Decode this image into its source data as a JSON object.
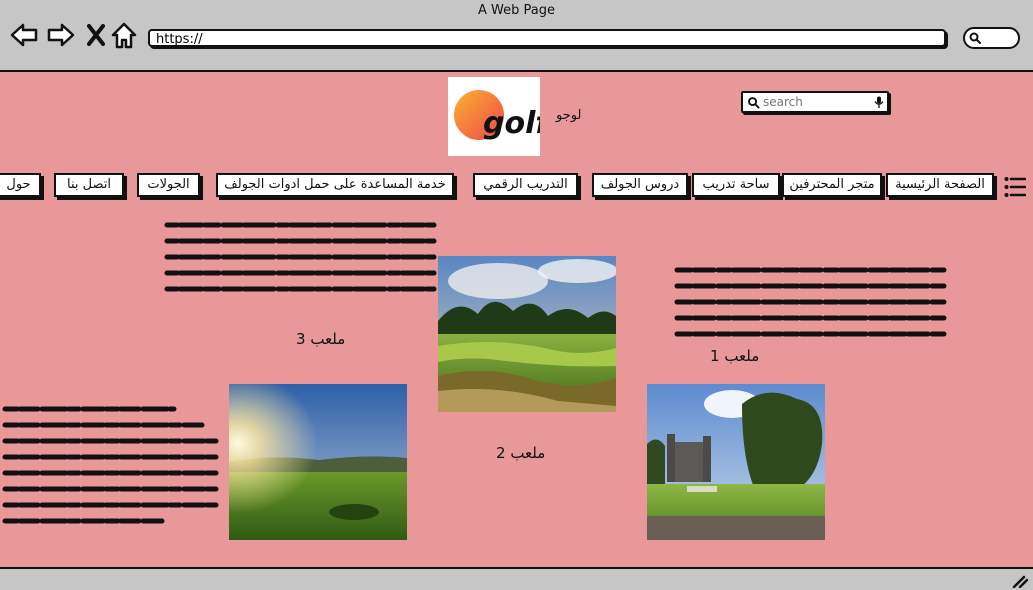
{
  "window": {
    "title": "A Web Page"
  },
  "browser": {
    "url": "https://"
  },
  "header": {
    "logo_text": "golf",
    "logo_label": "لوجو",
    "search_placeholder": "search"
  },
  "nav": {
    "items": [
      "الصفحة الرئيسية",
      "متجر المحترفين",
      "ساحة تدريب",
      "دروس الجولف",
      "التدريب الرقمي",
      "خدمة المساعدة على حمل ادوات الجولف",
      "الجولات",
      "اتصل بنا",
      "حول"
    ]
  },
  "courses": [
    {
      "caption": "ملعب 1"
    },
    {
      "caption": "ملعب 2"
    },
    {
      "caption": "ملعب 3"
    }
  ],
  "colors": {
    "page_bg": "#e89898",
    "chrome": "#c6c6c6",
    "ink": "#111111"
  }
}
